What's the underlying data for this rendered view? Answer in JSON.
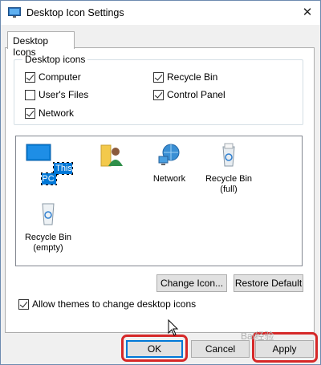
{
  "window": {
    "title": "Desktop Icon Settings",
    "close_glyph": "✕"
  },
  "tabs": [
    {
      "label": "Desktop Icons",
      "selected": true
    }
  ],
  "desktop_icons_group": {
    "label": "Desktop icons",
    "checkboxes": [
      {
        "label": "Computer",
        "checked": true
      },
      {
        "label": "Recycle Bin",
        "checked": true
      },
      {
        "label": "User's Files",
        "checked": false
      },
      {
        "label": "Control Panel",
        "checked": true
      },
      {
        "label": "Network",
        "checked": true
      }
    ]
  },
  "icon_list": {
    "items": [
      {
        "label": "This PC",
        "icon": "monitor-icon",
        "selected": true
      },
      {
        "label": "",
        "icon": "user-folder-icon",
        "selected": false
      },
      {
        "label": "Network",
        "icon": "network-globe-icon",
        "selected": false
      },
      {
        "label": "Recycle Bin\n(full)",
        "line1": "Recycle Bin",
        "line2": "(full)",
        "icon": "recycle-bin-full-icon",
        "selected": false
      },
      {
        "label": "Recycle Bin\n(empty)",
        "line1": "Recycle Bin",
        "line2": "(empty)",
        "icon": "recycle-bin-empty-icon",
        "selected": false
      }
    ]
  },
  "buttons": {
    "change_icon": "Change Icon...",
    "restore_default": "Restore Default",
    "ok": "OK",
    "cancel": "Cancel",
    "apply": "Apply"
  },
  "allow_themes": {
    "label": "Allow themes to change desktop icons",
    "checked": true
  },
  "watermark": "Bai经验",
  "colors": {
    "accent": "#0078d7",
    "highlight_annotation": "#d62828"
  }
}
